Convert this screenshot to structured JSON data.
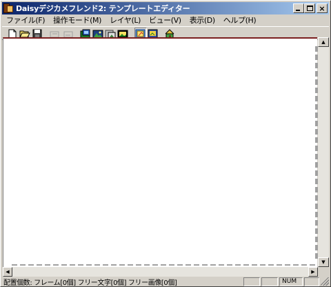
{
  "window": {
    "title": "Daisyデジカメフレンド2: テンプレートエディター",
    "controls": {
      "minimize": "minimize",
      "maximize": "maximize",
      "close": "×"
    }
  },
  "menu": {
    "items": [
      {
        "label": "ファイル(F)"
      },
      {
        "label": "操作モード(M)"
      },
      {
        "label": "レイヤ(L)"
      },
      {
        "label": "ビュー(V)"
      },
      {
        "label": "表示(D)"
      },
      {
        "label": "ヘルプ(H)"
      }
    ]
  },
  "toolbar": {
    "buttons": [
      {
        "icon": "new-document-icon",
        "enabled": true
      },
      {
        "icon": "open-folder-icon",
        "enabled": true
      },
      {
        "icon": "save-disk-icon",
        "enabled": true
      },
      {
        "icon": "undo-icon",
        "enabled": false
      },
      {
        "icon": "redo-icon",
        "enabled": false
      },
      {
        "icon": "frame-layer-icon",
        "enabled": true
      },
      {
        "icon": "photo-layer-icon",
        "enabled": true
      },
      {
        "icon": "image-layer-icon",
        "enabled": true
      },
      {
        "icon": "picture-icon",
        "enabled": true
      },
      {
        "icon": "edit-mode-icon",
        "enabled": true,
        "pressed": true
      },
      {
        "icon": "preview-mode-icon",
        "enabled": true
      },
      {
        "icon": "house-icon",
        "enabled": true
      }
    ]
  },
  "statusbar": {
    "text": "配置個数: フレーム[0個] フリー文字[0個] フリー画像[0個]",
    "panels": [
      "",
      "",
      "NUM",
      ""
    ]
  },
  "colors": {
    "titlebar_start": "#0a246a",
    "titlebar_end": "#a6caf0",
    "chrome": "#d4d0c8",
    "canvas": "#ffffff",
    "canvas_top_border": "#7a1e1e"
  }
}
